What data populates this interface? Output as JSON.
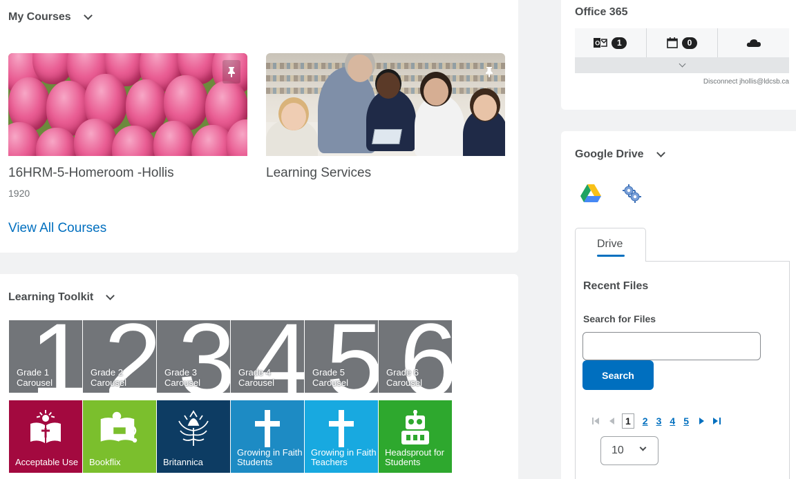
{
  "my_courses": {
    "heading": "My Courses",
    "view_all": "View All Courses",
    "courses": [
      {
        "title": "16HRM-5-Homeroom -Hollis",
        "code": "1920"
      },
      {
        "title": "Learning Services",
        "code": ""
      }
    ]
  },
  "learning_toolkit": {
    "heading": "Learning Toolkit",
    "grades": [
      {
        "number": "1",
        "label": "Grade 1 Carousel"
      },
      {
        "number": "2",
        "label": "Grade 2 Carousel"
      },
      {
        "number": "3",
        "label": "Grade 3 Carousel"
      },
      {
        "number": "4",
        "label": "Grade 4 Carousel"
      },
      {
        "number": "5",
        "label": "Grade 5 Carousel"
      },
      {
        "number": "6",
        "label": "Grade 6 Carousel"
      }
    ],
    "resources": [
      {
        "label": "Acceptable Use",
        "color": "#a3093f"
      },
      {
        "label": "Bookflix",
        "color": "#7bbf2d"
      },
      {
        "label": "Britannica",
        "color": "#0d3c63"
      },
      {
        "label": "Growing in Faith Students",
        "color": "#1d8bc4"
      },
      {
        "label": "Growing in Faith Teachers",
        "color": "#18a9e0"
      },
      {
        "label": "Headsprout for Students",
        "color": "#2ea82e"
      }
    ]
  },
  "office365": {
    "heading": "Office 365",
    "mail_count": "1",
    "calendar_count": "0",
    "disconnect": "Disconnect jhollis@ldcsb.ca"
  },
  "google_drive": {
    "heading": "Google Drive",
    "tab": "Drive",
    "recent_files": "Recent Files",
    "search_label": "Search for Files",
    "search_value": "",
    "search_button": "Search",
    "pages": [
      "1",
      "2",
      "3",
      "4",
      "5"
    ],
    "current_page": "1",
    "page_size": "10"
  },
  "colors": {
    "accent": "#006fbf",
    "grade_tile": "#727579"
  }
}
